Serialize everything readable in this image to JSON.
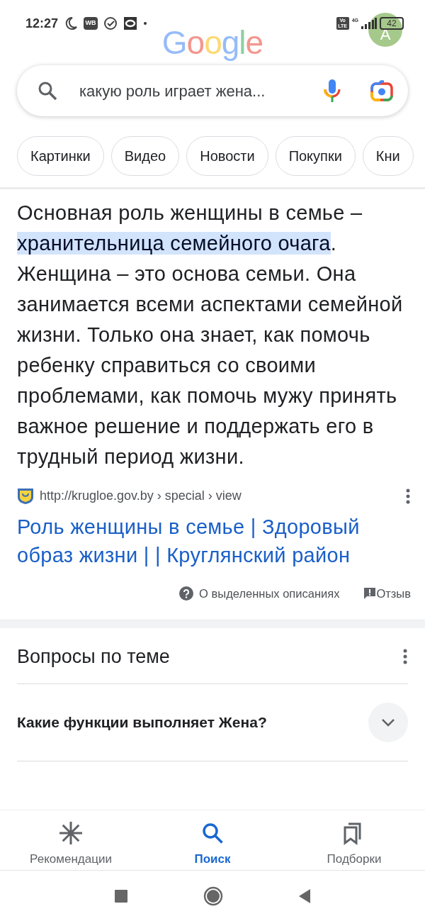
{
  "status_bar": {
    "time": "12:27",
    "wb_icon_label": "WB",
    "volte_top": "Vo",
    "volte_bottom": "LTE",
    "network": "4G",
    "battery": "42"
  },
  "header": {
    "logo": "Google",
    "avatar": "A"
  },
  "search": {
    "value": "какую роль играет жена..."
  },
  "chips": [
    {
      "label": "Картинки"
    },
    {
      "label": "Видео"
    },
    {
      "label": "Новости"
    },
    {
      "label": "Покупки"
    },
    {
      "label": "Кни"
    }
  ],
  "snippet": {
    "before": "Основная роль женщины в семье – ",
    "highlight": "хранительница семейного очага",
    "after": ". Женщина – это основа семьи. Она занимается всеми аспектами семейной жизни. Только она знает, как помочь ребенку справиться со своими проблемами, как помочь мужу принять важное решение и поддержать его в трудный период жизни.",
    "source_url": "http://krugloe.gov.by › special › view",
    "title": "Роль женщины в семье | Здоровый образ жизни | | Круглянский район",
    "about": "О выделенных описаниях",
    "feedback": "Отзыв"
  },
  "related": {
    "title": "Вопросы по теме",
    "questions": [
      {
        "text": "Какие функции выполняет Жена?",
        "expanded": false
      }
    ]
  },
  "bottom_nav": [
    {
      "label": "Рекомендации",
      "kind": "asterisk",
      "selected": false
    },
    {
      "label": "Поиск",
      "kind": "search",
      "selected": true
    },
    {
      "label": "Подборки",
      "kind": "collections",
      "selected": false
    }
  ]
}
